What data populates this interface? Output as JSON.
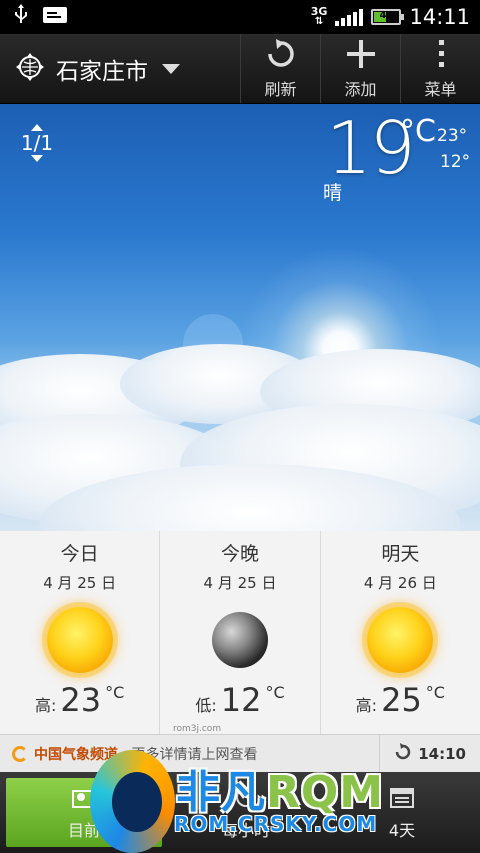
{
  "status_bar": {
    "network": "3G",
    "battery": "46",
    "battery_level": 0.46,
    "time": "14:11",
    "icons": [
      "usb-icon",
      "notification-card-icon",
      "signal-icon",
      "battery-icon"
    ]
  },
  "action_bar": {
    "city": "石家庄市",
    "refresh_label": "刷新",
    "add_label": "添加",
    "menu_label": "菜单"
  },
  "current": {
    "page_indicator": "1/1",
    "temp": "19",
    "unit": "°C",
    "high": "23°",
    "low": "12°",
    "condition": "晴"
  },
  "forecast": [
    {
      "day": "今日",
      "date": "4 月 25 日",
      "icon": "sun-icon",
      "temp_label": "高:",
      "temp": "23",
      "unit": "°C"
    },
    {
      "day": "今晚",
      "date": "4 月 25 日",
      "icon": "moon-icon",
      "temp_label": "低:",
      "temp": "12",
      "unit": "°C"
    },
    {
      "day": "明天",
      "date": "4 月 26 日",
      "icon": "sun-icon",
      "temp_label": "高:",
      "temp": "25",
      "unit": "°C"
    }
  ],
  "watermark_small": "rom3j.com",
  "ticker": {
    "source": "中国气象频道",
    "text": "- 更多详情请上网查看",
    "updated": "14:10"
  },
  "tabs": [
    {
      "label": "目前"
    },
    {
      "label": "每小时"
    },
    {
      "label": "4天"
    }
  ],
  "brand": {
    "cn": "非凡",
    "rom": "RQM",
    "url": "ROM.CRSKY.COM"
  },
  "colors": {
    "active_tab": "#7cc23a",
    "ticker_text": "#c34a00",
    "sky_top": "#1c5fb4"
  }
}
